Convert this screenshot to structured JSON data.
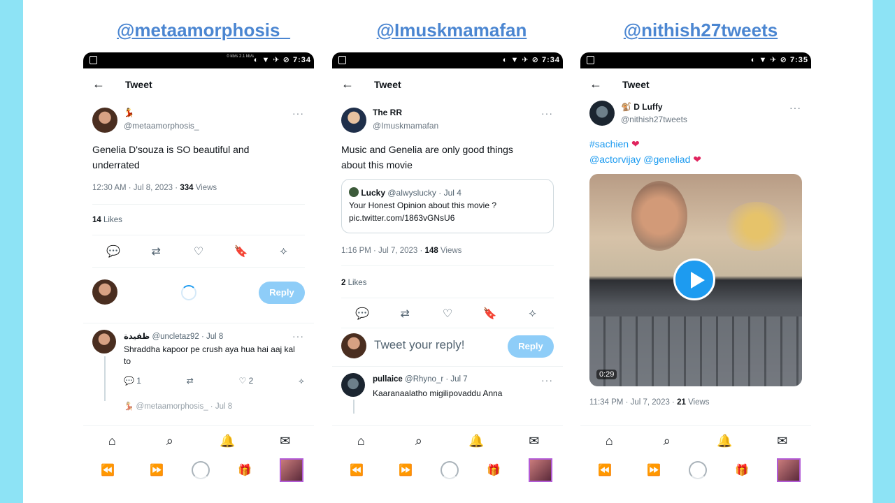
{
  "headers": [
    "@metaamorphosis_",
    "@Imuskmamafan",
    "@nithish27tweets"
  ],
  "status_time": [
    "7:34",
    "7:34",
    "7:35"
  ],
  "status_speed": "0 kb/s\n2.1 kb/s",
  "topbar_title": "Tweet",
  "p1": {
    "display_name": "💃",
    "handle": "@metaamorphosis_",
    "text": "Genelia D'souza is SO beautiful and underrated",
    "time": "12:30 AM · Jul 8, 2023 ·",
    "views_count": "334",
    "views_label": "Views",
    "likes_count": "14",
    "likes_label": "Likes",
    "reply_btn": "Reply",
    "comment": {
      "name": "ظفيدة",
      "meta": "@uncletaz92 · Jul 8",
      "text": "Shraddha kapoor pe crush aya hua hai aaj kal to",
      "reply_count": "1",
      "like_count": "2"
    },
    "next_comment": "💃 @metaamorphosis_ · Jul 8"
  },
  "p2": {
    "display_name": "The RR",
    "handle": "@Imuskmamafan",
    "text": "Music and Genelia are only good things about this movie",
    "quote": {
      "name": "Lucky",
      "meta": "@alwyslucky · Jul 4",
      "text": "Your Honest Opinion about this movie ?",
      "link": "pic.twitter.com/1863vGNsU6"
    },
    "time": "1:16 PM · Jul 7, 2023 ·",
    "views_count": "148",
    "views_label": "Views",
    "likes_count": "2",
    "likes_label": "Likes",
    "reply_placeholder": "Tweet your reply!",
    "reply_btn": "Reply",
    "comment": {
      "name": "pullaice",
      "meta": "@Rhyno_r · Jul 7",
      "text": "Kaaranaalatho migilipovaddu Anna"
    }
  },
  "p3": {
    "display_name": "🐒 D Luffy",
    "handle": "@nithish27tweets",
    "hashtag": "#sachien",
    "mentions": "@actorvijay @geneliad",
    "video_duration": "0:29",
    "time": "11:34 PM · Jul 7, 2023 ·",
    "views_count": "21",
    "views_label": "Views"
  },
  "icons": {
    "back": "←",
    "more": "···",
    "reply": "💬",
    "retweet": "⇄",
    "like": "♡",
    "bookmark": "🔖",
    "share": "⟡",
    "home": "⌂",
    "search": "⌕",
    "bell": "🔔",
    "mail": "✉",
    "rewind": "⏪",
    "forward": "⏩",
    "gift": "🎁",
    "heart": "❤"
  }
}
